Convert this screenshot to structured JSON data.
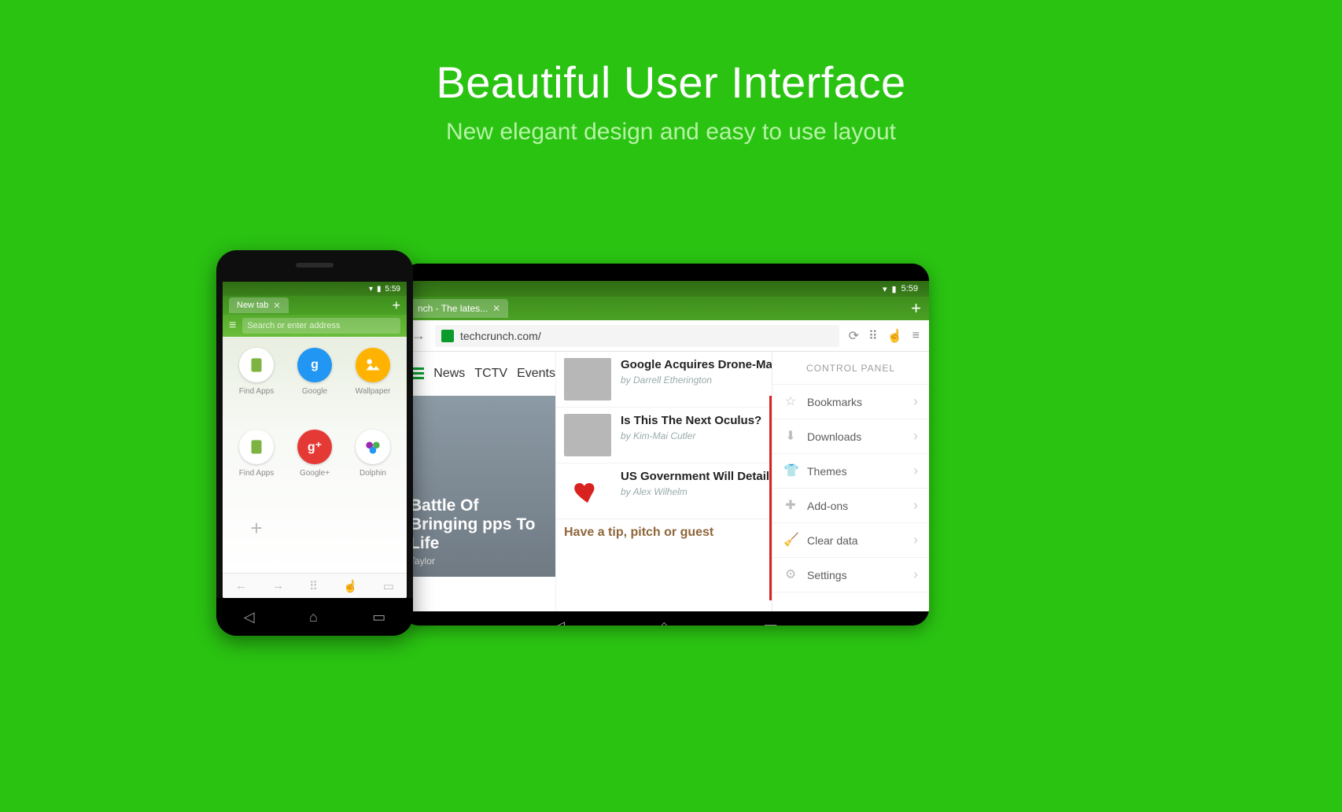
{
  "hero": {
    "title": "Beautiful User Interface",
    "subtitle": "New elegant design and easy to use layout"
  },
  "status_time": "5:59",
  "phone": {
    "tab_label": "New tab",
    "search_placeholder": "Search or enter address",
    "dials": {
      "find_apps": "Find Apps",
      "google": "Google",
      "wallpaper": "Wallpaper",
      "find_apps2": "Find Apps",
      "google_plus": "Google+",
      "dolphin": "Dolphin"
    }
  },
  "tablet": {
    "tab_label": "nch - The lates...",
    "url": "techcrunch.com/",
    "nav": {
      "news": "News",
      "tctv": "TCTV",
      "events": "Events"
    },
    "hero_article": {
      "title": "Battle Of Bringing pps To Life",
      "byline": "Taylor"
    },
    "articles": [
      {
        "title": "Google Acquires Drone-Maker Titan Aerospace",
        "byline": "by Darrell Etherington"
      },
      {
        "title": "Is This The Next Oculus?",
        "byline": "by Kim-Mai Cutler"
      },
      {
        "title": "US Government Will Detail Internet Exploits",
        "byline": "by Alex Wilhelm"
      }
    ],
    "tip": "Have a tip, pitch or guest",
    "control_panel": {
      "title": "CONTROL PANEL",
      "items": {
        "bookmarks": "Bookmarks",
        "downloads": "Downloads",
        "themes": "Themes",
        "addons": "Add-ons",
        "clear_data": "Clear data",
        "settings": "Settings"
      }
    }
  }
}
